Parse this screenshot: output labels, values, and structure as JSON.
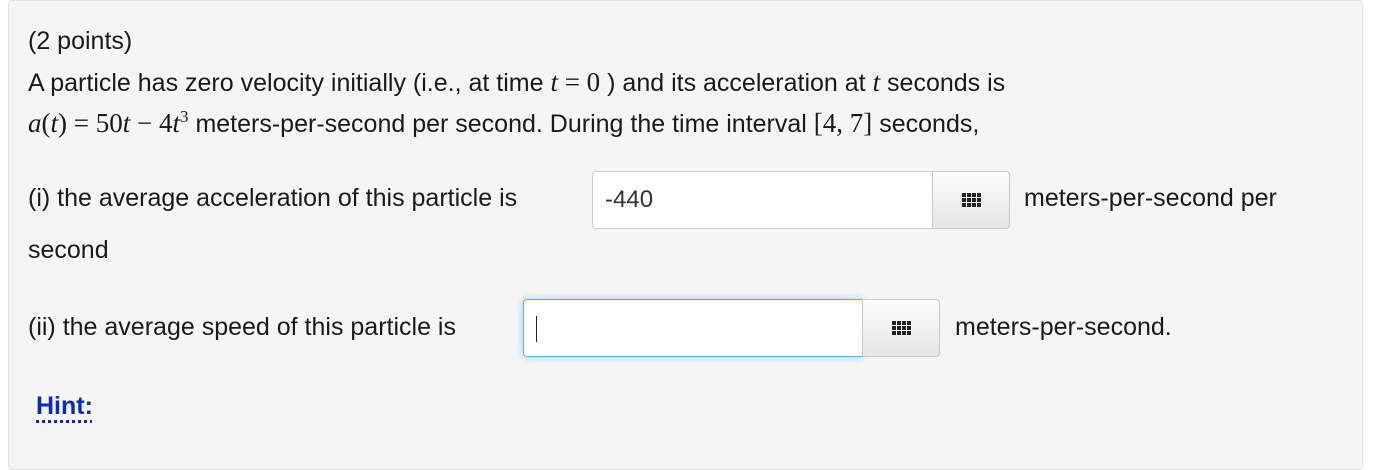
{
  "problem": {
    "points": "(2 points)",
    "line1_text": "A particle has zero velocity initially (i.e., at time",
    "line1_math": "t = 0",
    "line1_after": ") and its acceleration at",
    "line1_var": "t",
    "line1_end": "seconds is",
    "line2_math_a": "a(t) = 50t − 4t",
    "line2_math_exp": "3",
    "line2_text": "meters-per-second per second. During the time interval",
    "line2_interval": "[4, 7]",
    "line2_end": "seconds,"
  },
  "part_i": {
    "label": "(i) the average acceleration of this particle is",
    "value": "-440",
    "unit_line1": "meters-per-second per",
    "unit_line2": "second"
  },
  "part_ii": {
    "label": "(ii) the average speed of this particle is",
    "value": "",
    "unit": "meters-per-second."
  },
  "hint_label": "Hint:",
  "icons": {
    "equation_editor": "grid-icon"
  },
  "colors": {
    "hint_link": "#0a2bbf",
    "focus_border": "#66afe9"
  }
}
